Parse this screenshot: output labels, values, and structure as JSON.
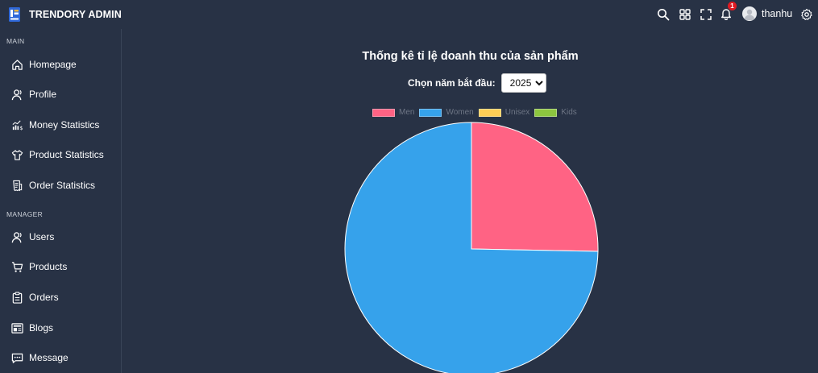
{
  "app": {
    "name": "TRENDORY ADMIN"
  },
  "topbar": {
    "notifications_count": "1",
    "username": "thanhu",
    "icons": [
      "search-icon",
      "grid-icon",
      "fullscreen-icon",
      "bell-icon",
      "avatar",
      "gear-icon"
    ]
  },
  "sidebar": {
    "sections": [
      {
        "label": "MAIN",
        "items": [
          {
            "label": "Homepage",
            "icon": "home-icon"
          },
          {
            "label": "Profile",
            "icon": "user-icon"
          },
          {
            "label": "Money Statistics",
            "icon": "money-chart-icon"
          },
          {
            "label": "Product Statistics",
            "icon": "shirt-icon"
          },
          {
            "label": "Order Statistics",
            "icon": "receipt-icon"
          }
        ]
      },
      {
        "label": "MANAGER",
        "items": [
          {
            "label": "Users",
            "icon": "user-icon"
          },
          {
            "label": "Products",
            "icon": "cart-icon"
          },
          {
            "label": "Orders",
            "icon": "clipboard-icon"
          },
          {
            "label": "Blogs",
            "icon": "blog-icon"
          },
          {
            "label": "Message",
            "icon": "message-icon"
          }
        ]
      }
    ]
  },
  "main": {
    "title": "Thống kê tỉ lệ doanh thu của sản phẩm",
    "year_label": "Chọn năm bắt đầu:",
    "year_selected": "2025"
  },
  "chart_data": {
    "type": "pie",
    "title": "",
    "legend_position": "top",
    "categories": [
      "Men",
      "Women",
      "Unisex",
      "Kids"
    ],
    "values": [
      25.3,
      74.7,
      0,
      0
    ],
    "colors": [
      "#ff6384",
      "#36a2eb",
      "#ffcd56",
      "#8dc63f"
    ]
  },
  "colors": {
    "background": "#283245",
    "sidebar_border": "#3a4558"
  }
}
